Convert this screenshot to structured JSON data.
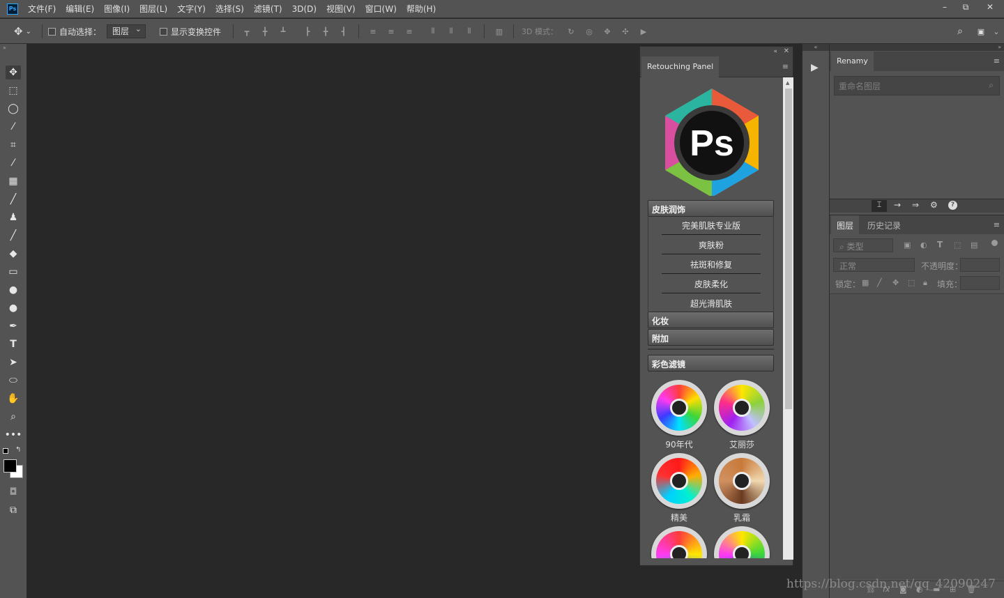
{
  "app": {
    "logo_text": "Ps"
  },
  "menu": [
    "文件(F)",
    "编辑(E)",
    "图像(I)",
    "图层(L)",
    "文字(Y)",
    "选择(S)",
    "滤镜(T)",
    "3D(D)",
    "视图(V)",
    "窗口(W)",
    "帮助(H)"
  ],
  "window_controls": {
    "minimize": "–",
    "restore": "⧉",
    "close": "✕"
  },
  "options": {
    "auto_select_label": "自动选择：",
    "auto_select_value": "图层",
    "show_transform_label": "显示变换控件",
    "mode_3d_label": "3D 模式："
  },
  "retouch_panel": {
    "tab": "Retouching Panel",
    "logo_text": "Ps",
    "sections": [
      {
        "title": "皮肤润饰",
        "items": [
          "完美肌肤专业版",
          "爽肤粉",
          "祛斑和修复",
          "皮肤柔化",
          "超光滑肌肤"
        ]
      },
      {
        "title": "化妆"
      },
      {
        "title": "附加"
      },
      {
        "title": "彩色滤镜"
      }
    ],
    "filters": [
      {
        "label": "90年代"
      },
      {
        "label": "艾丽莎"
      },
      {
        "label": "精美"
      },
      {
        "label": "乳霜"
      }
    ]
  },
  "renamy": {
    "tab": "Renamy",
    "search_placeholder": "重命名图层"
  },
  "layers": {
    "tabs": [
      "图层",
      "历史记录"
    ],
    "filter_kind": "类型",
    "blend_mode": "正常",
    "opacity_label": "不透明度：",
    "lock_label": "锁定：",
    "fill_label": "填充："
  },
  "watermark": "https://blog.csdn.net/qq_42090247",
  "colors": {
    "accent": "#31a8ff",
    "panel": "#535353",
    "canvas": "#282828"
  }
}
